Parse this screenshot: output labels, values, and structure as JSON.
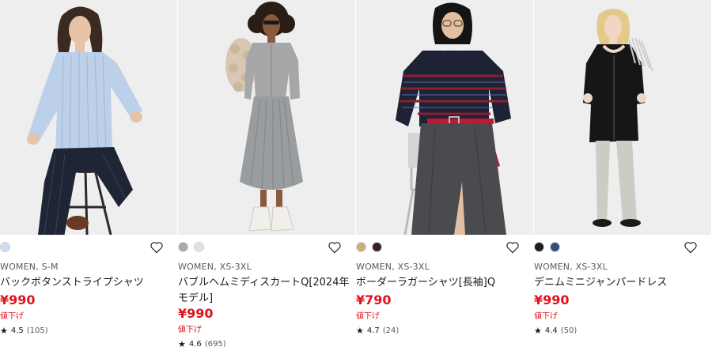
{
  "products": [
    {
      "category": "WOMEN, S-M",
      "name": "バックボタンストライプシャツ",
      "price": "¥990",
      "sale_label": "値下げ",
      "rating": "4.5",
      "review_count": "(105)",
      "swatch_colors": [
        "#cfdcef"
      ],
      "photo_alt": "product-photo-striped-shirt"
    },
    {
      "category": "WOMEN, XS-3XL",
      "name": "バブルヘムミディスカートQ[2024年モデル]",
      "price": "¥990",
      "sale_label": "値下げ",
      "rating": "4.6",
      "review_count": "(695)",
      "swatch_colors": [
        "#a9a9a9",
        "#e4e1dc"
      ],
      "photo_alt": "product-photo-bubble-skirt"
    },
    {
      "category": "WOMEN, XS-3XL",
      "name": "ボーダーラガーシャツ[長袖]Q",
      "price": "¥790",
      "sale_label": "値下げ",
      "rating": "4.7",
      "review_count": "(24)",
      "swatch_colors": [
        "#c8b07a",
        "#3a1f2a"
      ],
      "photo_alt": "product-photo-rugger-shirt"
    },
    {
      "category": "WOMEN, XS-3XL",
      "name": "デニムミニジャンパードレス",
      "price": "¥990",
      "sale_label": "値下げ",
      "rating": "4.4",
      "review_count": "(50)",
      "swatch_colors": [
        "#1f1f1f",
        "#34507a"
      ],
      "photo_alt": "product-photo-denim-dress"
    }
  ],
  "icons": {
    "favorite": "heart-outline-icon",
    "rating": "star-icon"
  },
  "colors": {
    "price": "#e0121c",
    "text": "#1b1b1b",
    "muted": "#5a5a5a",
    "photo_bg": "#eeeeee"
  }
}
